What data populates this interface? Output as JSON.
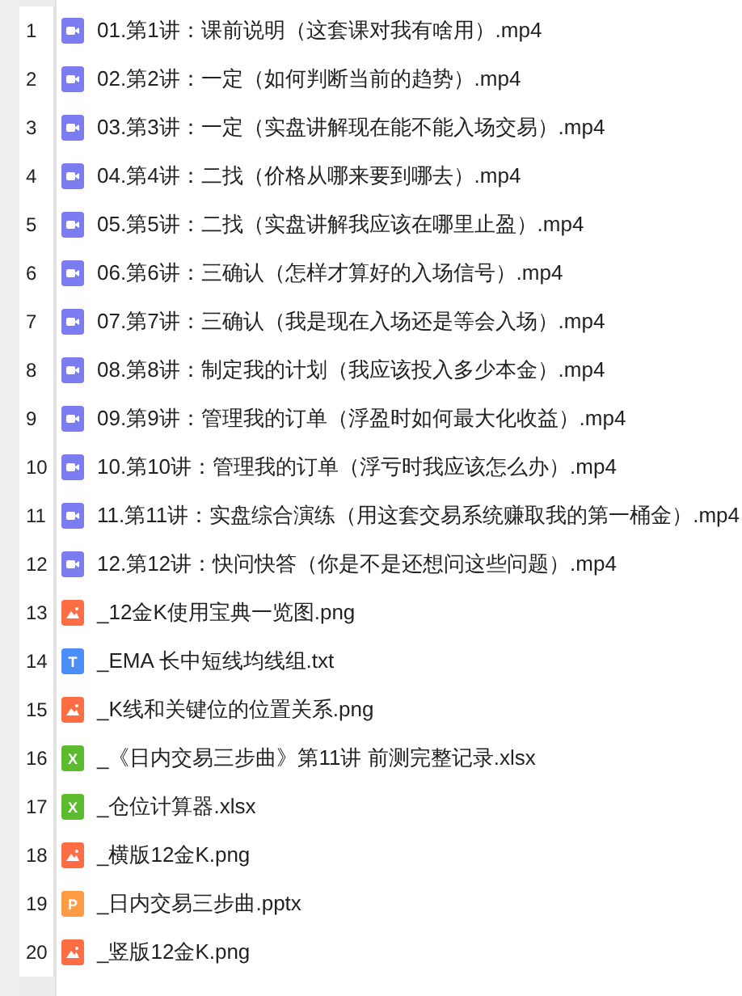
{
  "files": [
    {
      "number": "1",
      "kind": "video",
      "name": "01.第1讲：课前说明（这套课对我有啥用）.mp4"
    },
    {
      "number": "2",
      "kind": "video",
      "name": "02.第2讲：一定（如何判断当前的趋势）.mp4"
    },
    {
      "number": "3",
      "kind": "video",
      "name": "03.第3讲：一定（实盘讲解现在能不能入场交易）.mp4"
    },
    {
      "number": "4",
      "kind": "video",
      "name": "04.第4讲：二找（价格从哪来要到哪去）.mp4"
    },
    {
      "number": "5",
      "kind": "video",
      "name": "05.第5讲：二找（实盘讲解我应该在哪里止盈）.mp4"
    },
    {
      "number": "6",
      "kind": "video",
      "name": "06.第6讲：三确认（怎样才算好的入场信号）.mp4"
    },
    {
      "number": "7",
      "kind": "video",
      "name": "07.第7讲：三确认（我是现在入场还是等会入场）.mp4"
    },
    {
      "number": "8",
      "kind": "video",
      "name": "08.第8讲：制定我的计划（我应该投入多少本金）.mp4"
    },
    {
      "number": "9",
      "kind": "video",
      "name": "09.第9讲：管理我的订单（浮盈时如何最大化收益）.mp4"
    },
    {
      "number": "10",
      "kind": "video",
      "name": "10.第10讲：管理我的订单（浮亏时我应该怎么办）.mp4"
    },
    {
      "number": "11",
      "kind": "video",
      "name": "11.第11讲：实盘综合演练（用这套交易系统赚取我的第一桶金）.mp4"
    },
    {
      "number": "12",
      "kind": "video",
      "name": "12.第12讲：快问快答（你是不是还想问这些问题）.mp4"
    },
    {
      "number": "13",
      "kind": "image",
      "name": "_12金K使用宝典一览图.png"
    },
    {
      "number": "14",
      "kind": "text",
      "icon_letter": "T",
      "name": "_EMA 长中短线均线组.txt"
    },
    {
      "number": "15",
      "kind": "image",
      "name": "_K线和关键位的位置关系.png"
    },
    {
      "number": "16",
      "kind": "sheet",
      "icon_letter": "X",
      "name": "_《日内交易三步曲》第11讲 前测完整记录.xlsx"
    },
    {
      "number": "17",
      "kind": "sheet",
      "icon_letter": "X",
      "name": "_仓位计算器.xlsx"
    },
    {
      "number": "18",
      "kind": "image",
      "name": "_横版12金K.png"
    },
    {
      "number": "19",
      "kind": "slides",
      "icon_letter": "P",
      "name": "_日内交易三步曲.pptx"
    },
    {
      "number": "20",
      "kind": "image",
      "name": "_竖版12金K.png"
    }
  ]
}
